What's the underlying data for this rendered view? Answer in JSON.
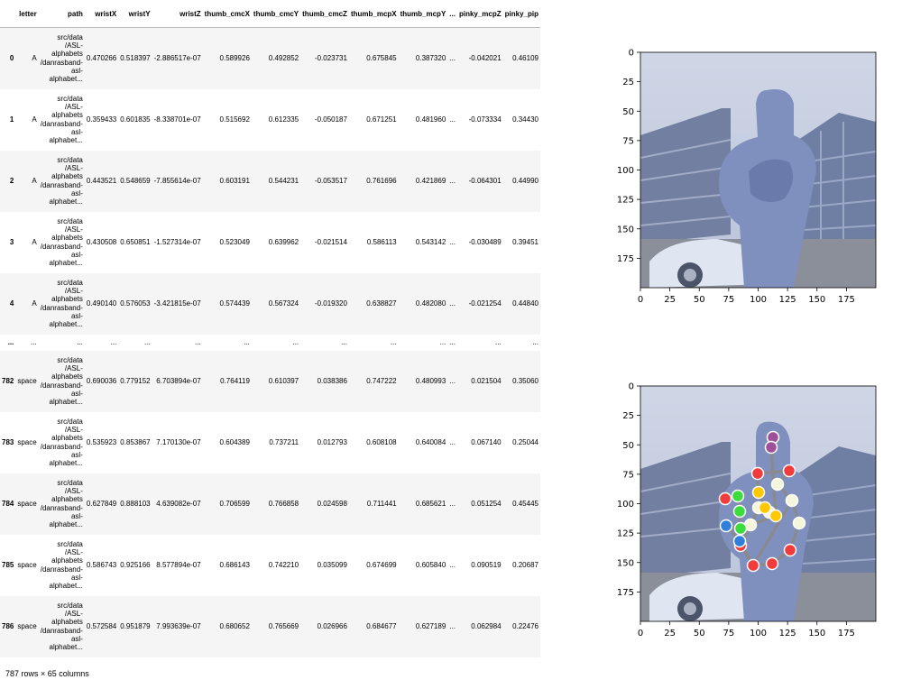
{
  "dataframe": {
    "columns": [
      "",
      "letter",
      "path",
      "wristX",
      "wristY",
      "wristZ",
      "thumb_cmcX",
      "thumb_cmcY",
      "thumb_cmcZ",
      "thumb_mcpX",
      "thumb_mcpY",
      "...",
      "pinky_mcpZ",
      "pinky_pip"
    ],
    "rows": [
      {
        "idx": "0",
        "letter": "A",
        "path": [
          "src/data",
          "/ASL-",
          "alphabets",
          "/danrasband-",
          "asl-",
          "alphabet..."
        ],
        "vals": [
          "0.470266",
          "0.518397",
          "-2.886517e-07",
          "0.589926",
          "0.492852",
          "-0.023731",
          "0.675845",
          "0.387320",
          "...",
          "-0.042021",
          "0.46109"
        ]
      },
      {
        "idx": "1",
        "letter": "A",
        "path": [
          "src/data",
          "/ASL-",
          "alphabets",
          "/danrasband-",
          "asl-",
          "alphabet..."
        ],
        "vals": [
          "0.359433",
          "0.601835",
          "-8.338701e-07",
          "0.515692",
          "0.612335",
          "-0.050187",
          "0.671251",
          "0.481960",
          "...",
          "-0.073334",
          "0.34430"
        ]
      },
      {
        "idx": "2",
        "letter": "A",
        "path": [
          "src/data",
          "/ASL-",
          "alphabets",
          "/danrasband-",
          "asl-",
          "alphabet..."
        ],
        "vals": [
          "0.443521",
          "0.548659",
          "-7.855614e-07",
          "0.603191",
          "0.544231",
          "-0.053517",
          "0.761696",
          "0.421869",
          "...",
          "-0.064301",
          "0.44990"
        ]
      },
      {
        "idx": "3",
        "letter": "A",
        "path": [
          "src/data",
          "/ASL-",
          "alphabets",
          "/danrasband-",
          "asl-",
          "alphabet..."
        ],
        "vals": [
          "0.430508",
          "0.650851",
          "-1.527314e-07",
          "0.523049",
          "0.639962",
          "-0.021514",
          "0.586113",
          "0.543142",
          "...",
          "-0.030489",
          "0.39451"
        ]
      },
      {
        "idx": "4",
        "letter": "A",
        "path": [
          "src/data",
          "/ASL-",
          "alphabets",
          "/danrasband-",
          "asl-",
          "alphabet..."
        ],
        "vals": [
          "0.490140",
          "0.576053",
          "-3.421815e-07",
          "0.574439",
          "0.567324",
          "-0.019320",
          "0.638827",
          "0.482080",
          "...",
          "-0.021254",
          "0.44840"
        ]
      },
      {
        "idx": "...",
        "letter": "...",
        "path": [
          "..."
        ],
        "vals": [
          "...",
          "...",
          "...",
          "...",
          "...",
          "...",
          "...",
          "...",
          "...",
          "...",
          "..."
        ],
        "ellipsis": true
      },
      {
        "idx": "782",
        "letter": "space",
        "path": [
          "src/data",
          "/ASL-",
          "alphabets",
          "/danrasband-",
          "asl-",
          "alphabet..."
        ],
        "vals": [
          "0.690036",
          "0.779152",
          "6.703894e-07",
          "0.764119",
          "0.610397",
          "0.038386",
          "0.747222",
          "0.480993",
          "...",
          "0.021504",
          "0.35060"
        ]
      },
      {
        "idx": "783",
        "letter": "space",
        "path": [
          "src/data",
          "/ASL-",
          "alphabets",
          "/danrasband-",
          "asl-",
          "alphabet..."
        ],
        "vals": [
          "0.535923",
          "0.853867",
          "7.170130e-07",
          "0.604389",
          "0.737211",
          "0.012793",
          "0.608108",
          "0.640084",
          "...",
          "0.067140",
          "0.25044"
        ]
      },
      {
        "idx": "784",
        "letter": "space",
        "path": [
          "src/data",
          "/ASL-",
          "alphabets",
          "/danrasband-",
          "asl-",
          "alphabet..."
        ],
        "vals": [
          "0.627849",
          "0.888103",
          "4.639082e-07",
          "0.706599",
          "0.766858",
          "0.024598",
          "0.711441",
          "0.685621",
          "...",
          "0.051254",
          "0.45445"
        ]
      },
      {
        "idx": "785",
        "letter": "space",
        "path": [
          "src/data",
          "/ASL-",
          "alphabets",
          "/danrasband-",
          "asl-",
          "alphabet..."
        ],
        "vals": [
          "0.586743",
          "0.925166",
          "8.577894e-07",
          "0.686143",
          "0.742210",
          "0.035099",
          "0.674699",
          "0.605840",
          "...",
          "0.090519",
          "0.20687"
        ]
      },
      {
        "idx": "786",
        "letter": "space",
        "path": [
          "src/data",
          "/ASL-",
          "alphabets",
          "/danrasband-",
          "asl-",
          "alphabet..."
        ],
        "vals": [
          "0.572584",
          "0.951879",
          "7.993639e-07",
          "0.680652",
          "0.765669",
          "0.026966",
          "0.684677",
          "0.627189",
          "...",
          "0.062984",
          "0.22476"
        ]
      }
    ],
    "shape_text": "787 rows × 65 columns"
  },
  "plots": {
    "top": {
      "y_ticks": [
        "0",
        "25",
        "50",
        "75",
        "100",
        "125",
        "150",
        "175"
      ],
      "x_ticks": [
        "0",
        "25",
        "50",
        "75",
        "100",
        "125",
        "150",
        "175"
      ]
    },
    "bottom": {
      "y_ticks": [
        "0",
        "25",
        "50",
        "75",
        "100",
        "125",
        "150",
        "175"
      ],
      "x_ticks": [
        "0",
        "25",
        "50",
        "75",
        "100",
        "125",
        "150",
        "175"
      ],
      "landmark_colors": {
        "palm": "#f03c3c",
        "thumb": "#f5f5dc",
        "index": "#ffc800",
        "middle": "#3cdc3c",
        "ring": "#2f7fdb",
        "pinky": "#a0509a",
        "connection": "#8a8a8a"
      }
    }
  }
}
